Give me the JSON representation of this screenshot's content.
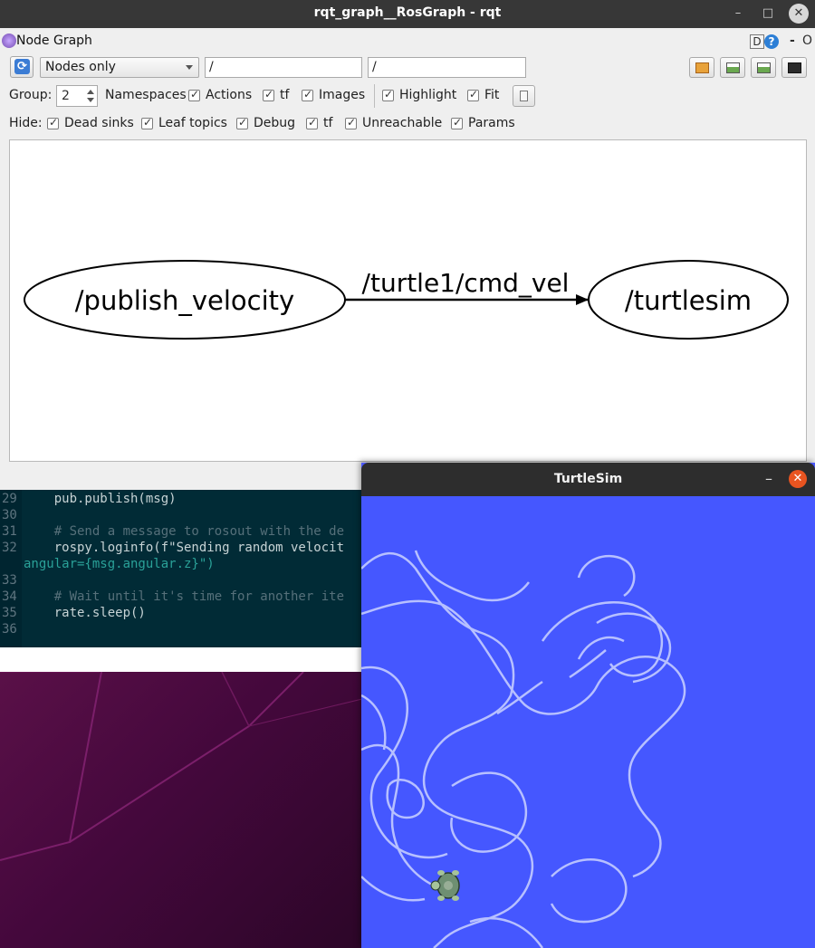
{
  "rqt_window": {
    "title": "rqt_graph__RosGraph - rqt",
    "controls": {
      "minimize": "–",
      "maximize": "□",
      "close": "✕"
    }
  },
  "plugin": {
    "title": "Node Graph",
    "help_d": "D",
    "help_q": "?",
    "dash": "-",
    "o": "O"
  },
  "toolbar": {
    "refresh_icon": "refresh-icon",
    "mode_value": "Nodes only",
    "filter1_value": "/",
    "filter2_value": "/",
    "buttons": [
      "open-icon",
      "save-dot-icon",
      "save-image-icon",
      "screenshot-icon"
    ]
  },
  "options": {
    "group_label": "Group:",
    "group_value": "2",
    "namespaces": "Namespaces",
    "actions": "Actions",
    "tf": "tf",
    "images": "Images",
    "highlight": "Highlight",
    "fit": "Fit"
  },
  "hide": {
    "label": "Hide:",
    "dead_sinks": "Dead sinks",
    "leaf_topics": "Leaf topics",
    "debug": "Debug",
    "tf": "tf",
    "unreachable": "Unreachable",
    "params": "Params"
  },
  "graph": {
    "node_a": "/publish_velocity",
    "edge": "/turtle1/cmd_vel",
    "node_b": "/turtlesim"
  },
  "editor": {
    "lines": [
      {
        "n": "29",
        "code": "    pub.publish(msg)"
      },
      {
        "n": "30",
        "code": ""
      },
      {
        "n": "31",
        "code": "    # Send a message to rosout with the de"
      },
      {
        "n": "32",
        "code": "    rospy.loginfo(f\"Sending random velocit"
      },
      {
        "n": "",
        "code": "angular={msg.angular.z}\")"
      },
      {
        "n": "33",
        "code": ""
      },
      {
        "n": "34",
        "code": "    # Wait until it's time for another ite"
      },
      {
        "n": "35",
        "code": "    rate.sleep()"
      },
      {
        "n": "36",
        "code": ""
      }
    ]
  },
  "turtlesim": {
    "title": "TurtleSim",
    "min": "–",
    "close": "✕",
    "turtle_icon": "turtle-icon"
  },
  "colors": {
    "turtlesim_bg": "#4557ff",
    "editor_bg": "#012b36",
    "desktop_bg": "#44083c"
  }
}
